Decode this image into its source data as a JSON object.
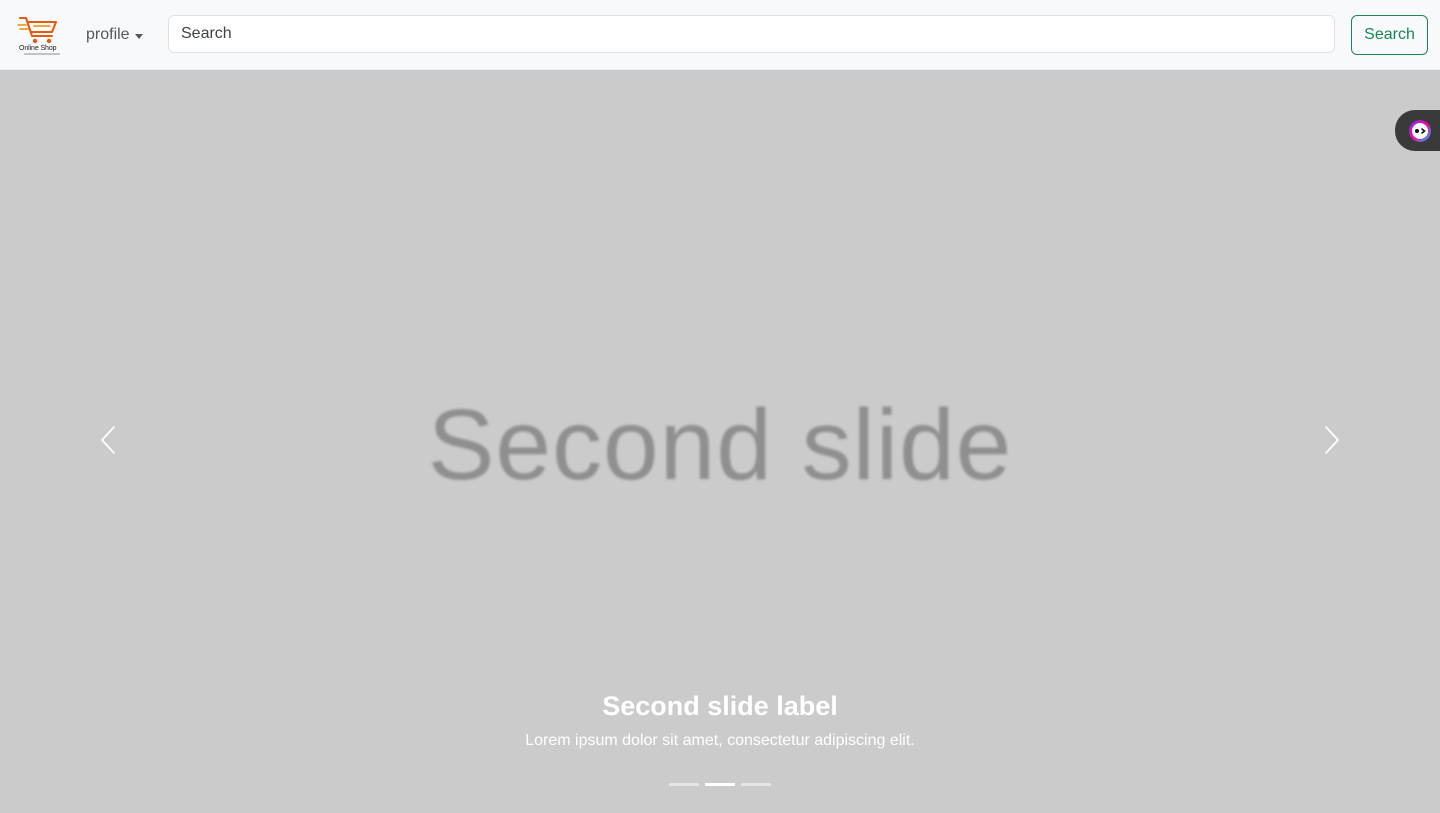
{
  "navbar": {
    "brand_name": "Online Shop",
    "profile_label": "profile",
    "search": {
      "placeholder": "Search",
      "value": ""
    },
    "search_button_label": "Search"
  },
  "carousel": {
    "slide_text": "Second slide",
    "caption": {
      "title": "Second slide label",
      "text": "Lorem ipsum dolor sit amet, consectetur adipiscing elit."
    },
    "slide_count": 3,
    "active_index": 1,
    "background_color": "#cbcbcb"
  },
  "colors": {
    "navbar_bg": "#f8f9fa",
    "search_button_accent": "#198754",
    "brand_cart": "#e8590c"
  },
  "icons": [
    "shopping-cart-icon",
    "caret-down-icon",
    "chevron-left-icon",
    "chevron-right-icon",
    "extension-icon"
  ]
}
